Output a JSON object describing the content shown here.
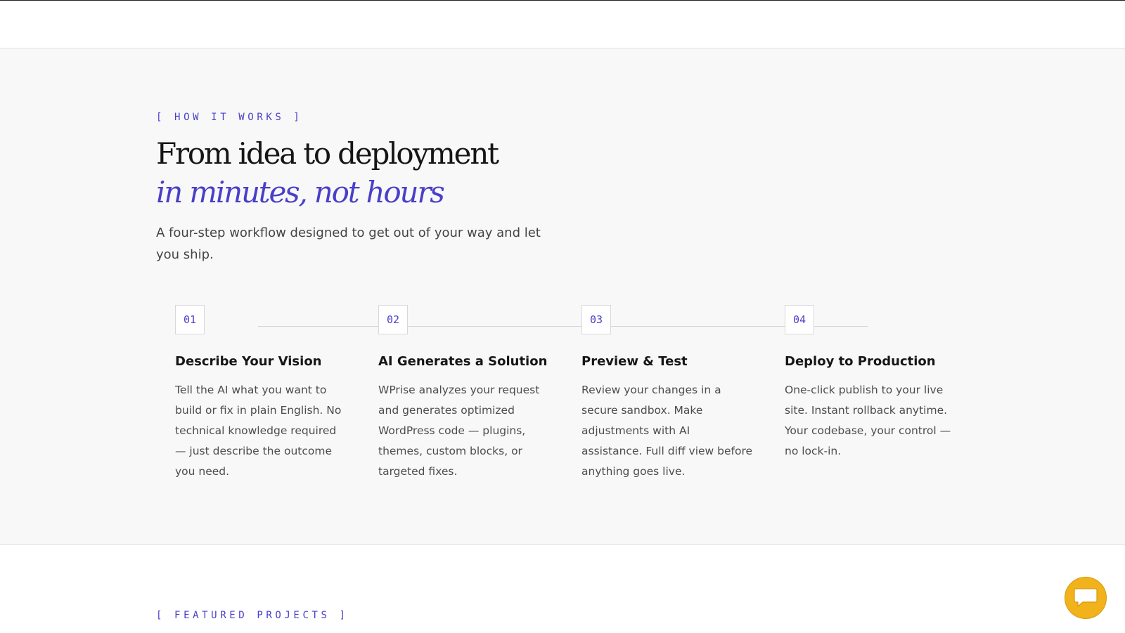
{
  "how_it_works": {
    "eyebrow": "[ HOW IT WORKS ]",
    "headline_line1": "From idea to deployment",
    "headline_line2": "in minutes, not hours",
    "lead": "A four-step workflow designed to get out of your way and let you ship.",
    "steps": [
      {
        "number": "01",
        "title": "Describe Your Vision",
        "description": "Tell the AI what you want to build or fix in plain English. No technical knowledge required — just describe the outcome you need."
      },
      {
        "number": "02",
        "title": "AI Generates a Solution",
        "description": "WPrise analyzes your request and generates optimized WordPress code — plugins, themes, custom blocks, or targeted fixes."
      },
      {
        "number": "03",
        "title": "Preview & Test",
        "description": "Review your changes in a secure sandbox. Make adjustments with AI assistance. Full diff view before anything goes live."
      },
      {
        "number": "04",
        "title": "Deploy to Production",
        "description": "One-click publish to your live site. Instant rollback anytime. Your codebase, your control — no lock-in."
      }
    ]
  },
  "featured_projects": {
    "eyebrow": "[ FEATURED PROJECTS ]"
  },
  "chat_widget": {
    "icon": "chat-bubble-icon"
  },
  "colors": {
    "accent": "#4a3fc9",
    "section_background": "#f8f8f8",
    "chat_button": "#f2b21c"
  }
}
